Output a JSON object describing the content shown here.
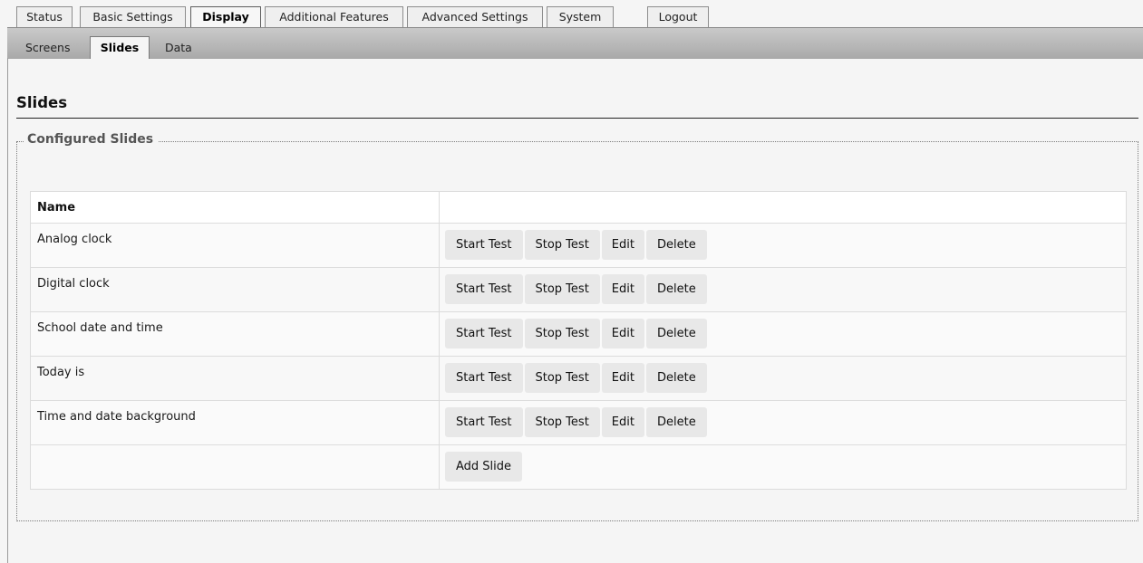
{
  "top_tabs": [
    {
      "label": "Status",
      "active": false
    },
    {
      "label": "Basic Settings",
      "active": false
    },
    {
      "label": "Display",
      "active": true
    },
    {
      "label": "Additional Features",
      "active": false
    },
    {
      "label": "Advanced Settings",
      "active": false
    },
    {
      "label": "System",
      "active": false
    },
    {
      "label": "Logout",
      "active": false
    }
  ],
  "sub_tabs": [
    {
      "label": "Screens",
      "active": false
    },
    {
      "label": "Slides",
      "active": true
    },
    {
      "label": "Data",
      "active": false
    }
  ],
  "page": {
    "title": "Slides",
    "fieldset_legend": "Configured Slides"
  },
  "table": {
    "header_name": "Name",
    "rows": [
      {
        "name": "Analog clock"
      },
      {
        "name": "Digital clock"
      },
      {
        "name": "School date and time"
      },
      {
        "name": "Today is"
      },
      {
        "name": "Time and date background"
      }
    ],
    "row_actions": {
      "start_test": "Start Test",
      "stop_test": "Stop Test",
      "edit": "Edit",
      "delete": "Delete"
    },
    "add_slide_label": "Add Slide"
  }
}
